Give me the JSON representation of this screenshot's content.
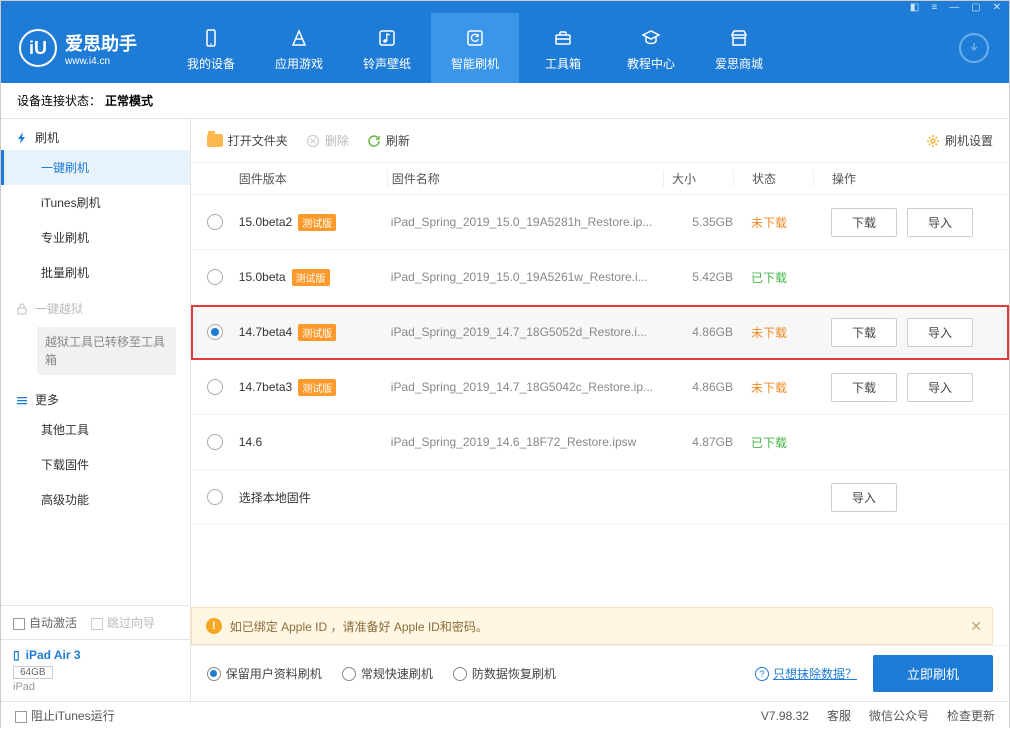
{
  "titlebar": {
    "icons": [
      "tshirt",
      "menu",
      "min",
      "max",
      "close"
    ]
  },
  "app": {
    "name": "爱思助手",
    "site": "www.i4.cn"
  },
  "nav": [
    {
      "label": "我的设备",
      "icon": "phone"
    },
    {
      "label": "应用游戏",
      "icon": "apps"
    },
    {
      "label": "铃声壁纸",
      "icon": "music"
    },
    {
      "label": "智能刷机",
      "icon": "refresh",
      "active": true
    },
    {
      "label": "工具箱",
      "icon": "toolbox"
    },
    {
      "label": "教程中心",
      "icon": "education"
    },
    {
      "label": "爱思商城",
      "icon": "store"
    }
  ],
  "status": {
    "label": "设备连接状态：",
    "value": "正常模式"
  },
  "sidebar": {
    "groups": [
      {
        "title": "刷机",
        "icon": "flash",
        "items": [
          {
            "label": "一键刷机",
            "active": true
          },
          {
            "label": "iTunes刷机"
          },
          {
            "label": "专业刷机"
          },
          {
            "label": "批量刷机"
          }
        ]
      },
      {
        "title": "一键越狱",
        "icon": "lock",
        "disabled": true,
        "note": "越狱工具已转移至工具箱"
      },
      {
        "title": "更多",
        "icon": "more",
        "items": [
          {
            "label": "其他工具"
          },
          {
            "label": "下载固件"
          },
          {
            "label": "高级功能"
          }
        ]
      }
    ],
    "auto_activate": "自动激活",
    "skip_guide": "跳过向导",
    "device": {
      "name": "iPad Air 3",
      "capacity": "64GB",
      "model": "iPad"
    }
  },
  "toolbar": {
    "open": "打开文件夹",
    "delete": "删除",
    "refresh": "刷新",
    "settings": "刷机设置"
  },
  "table": {
    "headers": {
      "version": "固件版本",
      "name": "固件名称",
      "size": "大小",
      "status": "状态",
      "ops": "操作"
    },
    "rows": [
      {
        "version": "15.0beta2",
        "beta": true,
        "name": "iPad_Spring_2019_15.0_19A5281h_Restore.ip...",
        "size": "5.35GB",
        "status": "未下载",
        "st": "orange",
        "selected": false,
        "download": true,
        "import": true
      },
      {
        "version": "15.0beta",
        "beta": true,
        "name": "iPad_Spring_2019_15.0_19A5261w_Restore.i...",
        "size": "5.42GB",
        "status": "已下载",
        "st": "green",
        "selected": false
      },
      {
        "version": "14.7beta4",
        "beta": true,
        "name": "iPad_Spring_2019_14.7_18G5052d_Restore.i...",
        "size": "4.86GB",
        "status": "未下载",
        "st": "orange",
        "selected": true,
        "highlight": true,
        "download": true,
        "import": true
      },
      {
        "version": "14.7beta3",
        "beta": true,
        "name": "iPad_Spring_2019_14.7_18G5042c_Restore.ip...",
        "size": "4.86GB",
        "status": "未下载",
        "st": "orange",
        "selected": false,
        "download": true,
        "import": true
      },
      {
        "version": "14.6",
        "beta": false,
        "name": "iPad_Spring_2019_14.6_18F72_Restore.ipsw",
        "size": "4.87GB",
        "status": "已下载",
        "st": "green",
        "selected": false
      },
      {
        "version": "选择本地固件",
        "local": true,
        "selected": false,
        "import": true
      }
    ],
    "btn_download": "下载",
    "btn_import": "导入",
    "badge": "测试版"
  },
  "info": {
    "text": "如已绑定 Apple ID ，请准备好 Apple ID和密码。"
  },
  "options": {
    "items": [
      {
        "label": "保留用户资料刷机",
        "selected": true
      },
      {
        "label": "常规快速刷机",
        "selected": false
      },
      {
        "label": "防数据恢复刷机",
        "selected": false
      }
    ],
    "link": "只想抹除数据？",
    "action": "立即刷机"
  },
  "footer": {
    "block_itunes": "阻止iTunes运行",
    "version": "V7.98.32",
    "items": [
      "客服",
      "微信公众号",
      "检查更新"
    ]
  }
}
